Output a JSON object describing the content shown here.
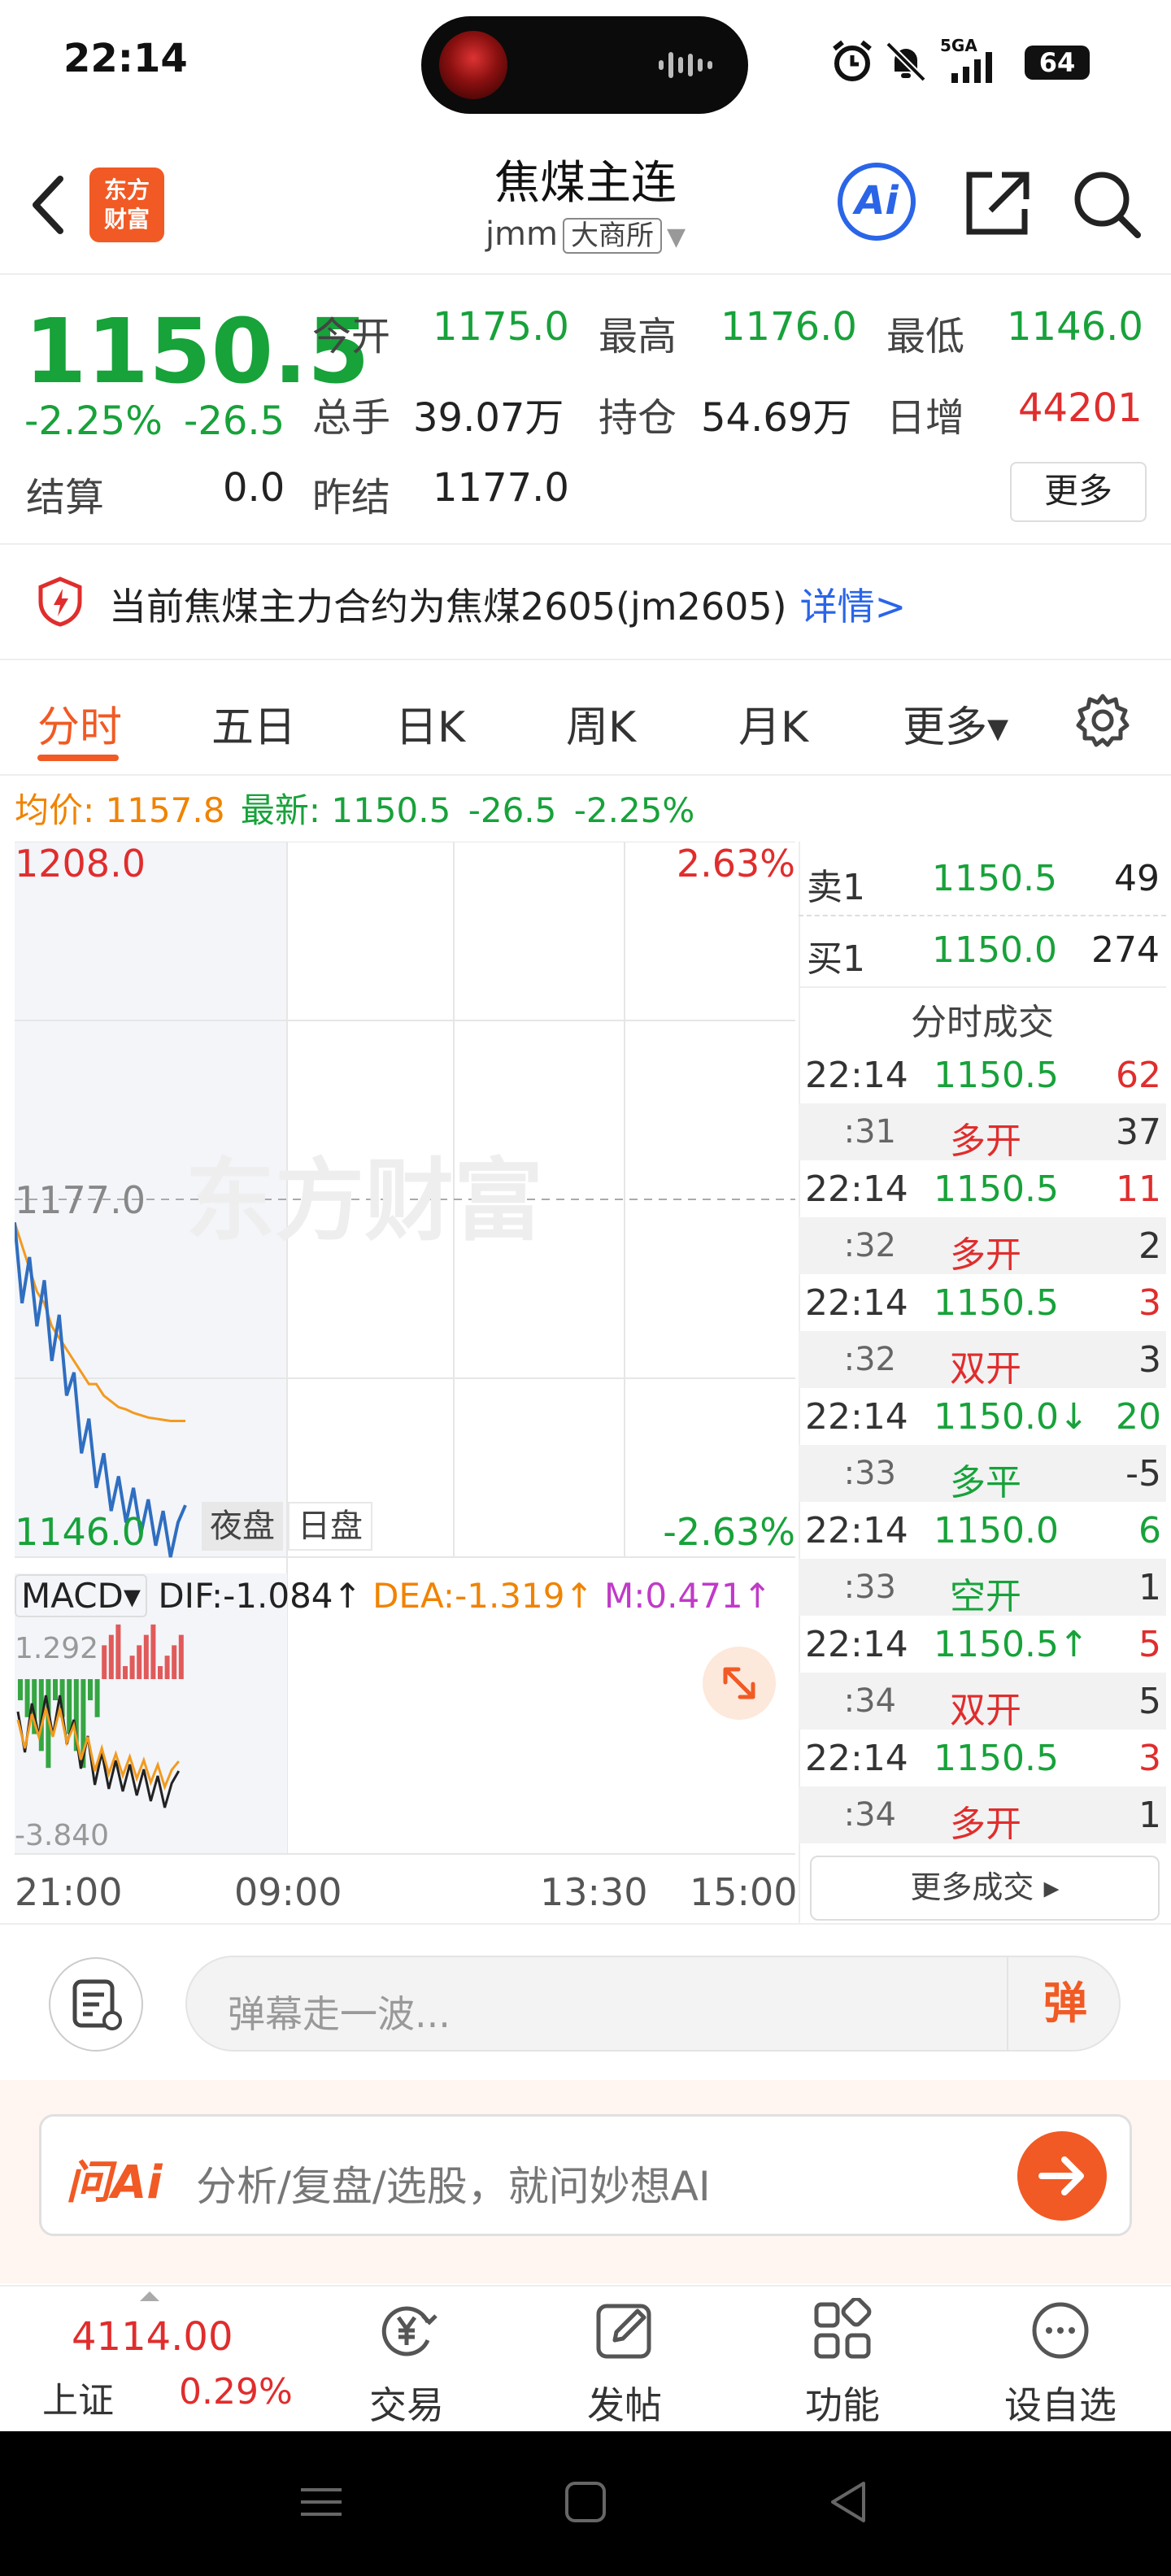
{
  "status_bar": {
    "time": "22:14",
    "battery": "64",
    "network": "5GA"
  },
  "header": {
    "title": "焦煤主连",
    "code": "jmm",
    "exchange": "大商所",
    "logo_text_line1": "东方",
    "logo_text_line2": "财富",
    "ai_label": "Ai"
  },
  "quote": {
    "price": "1150.5",
    "change_pct": "-2.25%",
    "change": "-26.5",
    "open_label": "今开",
    "open": "1175.0",
    "high_label": "最高",
    "high": "1176.0",
    "low_label": "最低",
    "low": "1146.0",
    "volume_label": "总手",
    "volume": "39.07万",
    "oi_label": "持仓",
    "oi": "54.69万",
    "daily_inc_label": "日增",
    "daily_inc": "44201",
    "settle_label": "结算",
    "settle": "0.0",
    "prev_settle_label": "昨结",
    "prev_settle": "1177.0",
    "more_label": "更多"
  },
  "notice": {
    "text": "当前焦煤主力合约为焦煤2605(jm2605)",
    "link": "详情>"
  },
  "tabs": [
    {
      "label": "分时",
      "active": true
    },
    {
      "label": "五日"
    },
    {
      "label": "日K"
    },
    {
      "label": "周K"
    },
    {
      "label": "月K"
    },
    {
      "label": "更多▾"
    }
  ],
  "info_line": {
    "avg_label": "均价:",
    "avg": "1157.8",
    "latest_label": "最新:",
    "latest": "1150.5",
    "chg": "-26.5",
    "pct": "-2.25%"
  },
  "chart": {
    "y_max": "1208.0",
    "y_mid": "1177.0",
    "y_min": "1146.0",
    "pct_max": "2.63%",
    "pct_min": "-2.63%",
    "watermark": "东方财富",
    "session_tags": [
      "夜盘",
      "日盘"
    ],
    "x_labels": [
      "21:00",
      "09:00",
      "13:30",
      "15:00"
    ],
    "macd": {
      "label": "MACD▾",
      "dif": "DIF:-1.084↑",
      "dea": "DEA:-1.319↑",
      "m": "M:0.471↑",
      "y_max": "1.292",
      "y_min": "-3.840"
    }
  },
  "chart_data": {
    "type": "line",
    "series": [
      {
        "values": [
          1175,
          1168,
          1172,
          1166,
          1170,
          1163,
          1167,
          1160,
          1162,
          1155,
          1158,
          1152,
          1155,
          1150,
          1153,
          1149,
          1152,
          1148,
          1151,
          1147,
          1150,
          1146,
          1149,
          1150.5
        ]
      },
      {
        "values": [
          1175,
          1173,
          1171,
          1169,
          1168,
          1166,
          1165,
          1164,
          1163,
          1162,
          1161,
          1161,
          1160,
          1159.5,
          1159,
          1158.8,
          1158.5,
          1158.3,
          1158.1,
          1158,
          1157.9,
          1157.8,
          1157.8,
          1157.8
        ]
      }
    ],
    "ylim": [
      1146.0,
      1208.0
    ]
  },
  "order_book": [
    {
      "label": "卖1",
      "price": "1150.5",
      "vol": "49"
    },
    {
      "label": "买1",
      "price": "1150.0",
      "vol": "274"
    }
  ],
  "trades_title": "分时成交",
  "trades": [
    {
      "t": "22:14",
      "price": "1150.5",
      "vol": "62",
      "vc": "red"
    },
    {
      "t": ":31",
      "type": "多开",
      "vol": "37",
      "tc": "red"
    },
    {
      "t": "22:14",
      "price": "1150.5",
      "vol": "11",
      "vc": "red"
    },
    {
      "t": ":32",
      "type": "多开",
      "vol": "2",
      "tc": "red"
    },
    {
      "t": "22:14",
      "price": "1150.5",
      "vol": "3",
      "vc": "red"
    },
    {
      "t": ":32",
      "type": "双开",
      "vol": "3",
      "tc": "red"
    },
    {
      "t": "22:14",
      "price": "1150.0↓",
      "vol": "20",
      "vc": "green"
    },
    {
      "t": ":33",
      "type": "多平",
      "vol": "-5",
      "tc": "green"
    },
    {
      "t": "22:14",
      "price": "1150.0",
      "vol": "6",
      "vc": "green"
    },
    {
      "t": ":33",
      "type": "空开",
      "vol": "1",
      "tc": "green"
    },
    {
      "t": "22:14",
      "price": "1150.5↑",
      "vol": "5",
      "vc": "red"
    },
    {
      "t": ":34",
      "type": "双开",
      "vol": "5",
      "tc": "red"
    },
    {
      "t": "22:14",
      "price": "1150.5",
      "vol": "3",
      "vc": "red"
    },
    {
      "t": ":34",
      "type": "多开",
      "vol": "1",
      "tc": "red"
    }
  ],
  "more_trades": "更多成交 ▸",
  "comment": {
    "placeholder": "弹幕走一波...",
    "danmu": "弹"
  },
  "ai_bar": {
    "logo": "问Ai",
    "placeholder": "分析/复盘/选股，就问妙想AI"
  },
  "bottom_nav": {
    "index_value": "4114.00",
    "index_name": "上证",
    "index_pct": "0.29%",
    "items": [
      {
        "label": "交易"
      },
      {
        "label": "发帖"
      },
      {
        "label": "功能"
      },
      {
        "label": "设自选"
      }
    ]
  }
}
